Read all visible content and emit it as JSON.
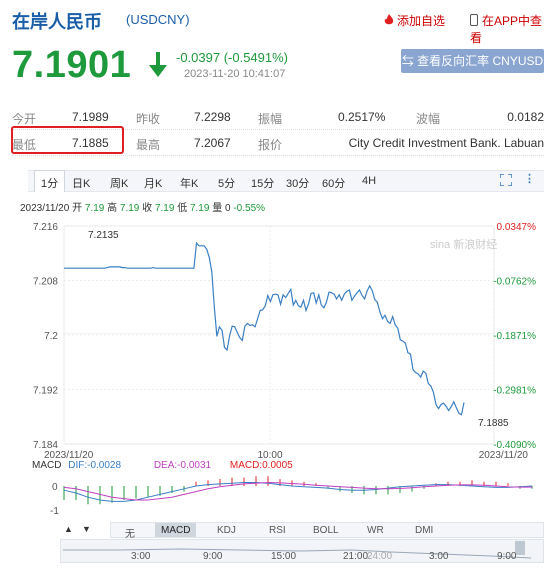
{
  "header": {
    "title": "在岸人民币",
    "code": "(USDCNY)",
    "fav_label": "添加自选",
    "app_label": "在APP中查看"
  },
  "quote": {
    "price": "7.1901",
    "change": "-0.0397 (-0.5491%)",
    "timestamp": "2023-11-20 10:41:07",
    "reverse_btn": "查看反向汇率 CNYUSD"
  },
  "stats": {
    "row1": [
      {
        "label": "今开",
        "value": "7.1989"
      },
      {
        "label": "昨收",
        "value": "7.2298"
      },
      {
        "label": "振幅",
        "value": "0.2517%"
      },
      {
        "label": "波幅",
        "value": "0.0182"
      }
    ],
    "row2": [
      {
        "label": "最低",
        "value": "7.1885"
      },
      {
        "label": "最高",
        "value": "7.2067"
      },
      {
        "label": "报价",
        "value": "City Credit Investment Bank. Labuan"
      }
    ]
  },
  "period_tabs": [
    "1分",
    "日K",
    "周K",
    "月K",
    "年K",
    "5分",
    "15分",
    "30分",
    "60分",
    "4H"
  ],
  "period_active": "1分",
  "ohlc": {
    "date": "2023/11/20",
    "open_label": "开",
    "open": "7.19",
    "high_label": "高",
    "high": "7.19",
    "close_label": "收",
    "close": "7.19",
    "low_label": "低",
    "low": "7.19",
    "vol_label": "量",
    "vol": "0",
    "pct": "-0.55%"
  },
  "watermark": "sina 新浪财经",
  "colors": {
    "down": "#1e9a3c",
    "up": "#e02020",
    "line": "#3b7fc4",
    "brand": "#1a5ea8"
  },
  "chart_data": {
    "type": "line",
    "title": "",
    "x_tick_labels": [
      "2023/11/20",
      "10:00",
      "2023/11/20"
    ],
    "ylim": [
      7.184,
      7.216
    ],
    "y_ticks": [
      "7.216",
      "7.208",
      "7.2",
      "7.192",
      "7.184"
    ],
    "pct_ticks": [
      "0.0347%",
      "-0.0762%",
      "-0.1871%",
      "-0.2981%",
      "-0.4090%"
    ],
    "annotations": {
      "high": "7.2135",
      "low": "7.1885"
    },
    "series": [
      {
        "values": [
          7.2098,
          7.2098,
          7.2098,
          7.2098,
          7.2098,
          7.2098,
          7.2098,
          7.2098,
          7.2098,
          7.2098,
          7.2098,
          7.2098,
          7.2098,
          7.2098,
          7.2098,
          7.2098,
          7.2098,
          7.2099,
          7.21,
          7.21,
          7.21,
          7.21,
          7.21,
          7.2099,
          7.2099,
          7.2098,
          7.2098,
          7.2098,
          7.2098,
          7.2098,
          7.2098,
          7.2098,
          7.2098,
          7.2098,
          7.2098,
          7.2099,
          7.2098,
          7.2098,
          7.2098,
          7.2098,
          7.2098,
          7.2098,
          7.2098,
          7.2098,
          7.2098,
          7.2098,
          7.2098,
          7.2098,
          7.2098,
          7.2098,
          7.2098,
          7.2098,
          7.2135,
          7.2131,
          7.2131,
          7.2131,
          7.2126,
          7.2114,
          7.2093,
          7.2041,
          7.1998,
          7.2012,
          7.2007,
          7.1982,
          7.1978,
          7.1999,
          7.2013,
          7.2012,
          7.2004,
          7.1996,
          7.1992,
          7.2013,
          7.2017,
          7.2014,
          7.2015,
          7.2012,
          7.2024,
          7.2036,
          7.2037,
          7.2043,
          7.2058,
          7.2049,
          7.2059,
          7.206,
          7.2059,
          7.2045,
          7.2059,
          7.2055,
          7.2061,
          7.2067,
          7.2044,
          7.2051,
          7.2043,
          7.2041,
          7.2051,
          7.2036,
          7.2046,
          7.2061,
          7.2062,
          7.2047,
          7.2059,
          7.2044,
          7.204,
          7.2048,
          7.2063,
          7.2062,
          7.206,
          7.2053,
          7.2059,
          7.2051,
          7.206,
          7.2064,
          7.2066,
          7.2051,
          7.2057,
          7.2062,
          7.2066,
          7.2058,
          7.2053,
          7.2065,
          7.2072,
          7.2065,
          7.2052,
          7.2048,
          7.2034,
          7.2024,
          7.2029,
          7.202,
          7.2017,
          7.2027,
          7.2015,
          7.201,
          7.1993,
          7.1991,
          7.1988,
          7.1974,
          7.1972,
          7.1949,
          7.1945,
          7.1943,
          7.1938,
          7.1947,
          7.1944,
          7.1929,
          7.1925,
          7.1916,
          7.1898,
          7.1892,
          7.1898,
          7.19,
          7.1895,
          7.1889,
          7.1895,
          7.1902,
          7.1893,
          7.1885,
          7.1883,
          7.1901
        ]
      }
    ]
  },
  "macd": {
    "title": "MACD",
    "dif_label": "DIF:",
    "dif": "-0.0028",
    "dea_label": "DEA:",
    "dea": "-0.0031",
    "macd_label": "MACD:",
    "macd": "0.0005",
    "y_ticks": [
      "0",
      "-1"
    ],
    "tabs": [
      "无",
      "MACD",
      "KDJ",
      "RSI",
      "BOLL",
      "WR",
      "DMI"
    ],
    "active": "MACD",
    "bars": [
      -1.0,
      -1.0,
      -1.3,
      -1.3,
      -1.2,
      -1.0,
      -0.9,
      -0.8,
      -0.7,
      -0.5,
      -0.4,
      0.3,
      0.4,
      0.5,
      0.6,
      0.6,
      0.7,
      0.7,
      0.5,
      0.4,
      0.3,
      0.2,
      -0.2,
      -0.4,
      -0.5,
      -0.6,
      -0.6,
      -0.6,
      -0.5,
      -0.4,
      -0.2,
      0.2,
      0.3,
      0.3,
      0.4,
      0.3,
      0.3,
      0.2,
      -0.2,
      -0.2
    ],
    "dif_line": [
      -0.3,
      -0.5,
      -0.8,
      -1.0,
      -1.1,
      -1.1,
      -1.0,
      -0.8,
      -0.6,
      -0.4,
      -0.2,
      0.0,
      0.1,
      0.15,
      0.2,
      0.25,
      0.25,
      0.2,
      0.1,
      0.0,
      -0.05,
      -0.1,
      -0.15,
      -0.25,
      -0.3,
      -0.3,
      -0.25,
      -0.15,
      -0.05,
      0.0,
      0.05,
      0.1,
      0.1,
      0.05,
      0.0,
      -0.05,
      -0.1,
      -0.1,
      -0.05,
      0.0
    ],
    "dea_line": [
      -0.1,
      -0.2,
      -0.4,
      -0.6,
      -0.8,
      -0.9,
      -1.0,
      -1.0,
      -0.9,
      -0.8,
      -0.6,
      -0.4,
      -0.2,
      -0.05,
      0.05,
      0.15,
      0.2,
      0.25,
      0.22,
      0.18,
      0.12,
      0.05,
      0.0,
      -0.05,
      -0.1,
      -0.15,
      -0.2,
      -0.2,
      -0.18,
      -0.12,
      -0.05,
      0.0,
      0.05,
      0.08,
      0.08,
      0.05,
      0.0,
      -0.05,
      -0.08,
      -0.08
    ]
  },
  "timeline_ticks": [
    "3:00",
    "9:00",
    "15:00",
    "21:00",
    "24:00",
    "3:00",
    "9:00"
  ]
}
